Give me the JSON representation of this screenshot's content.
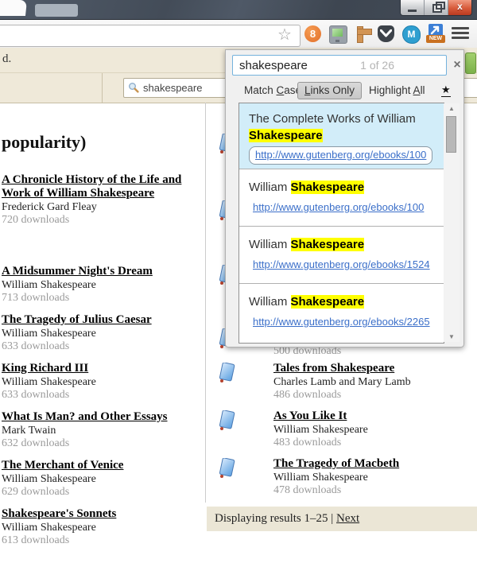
{
  "colors": {
    "titlebar": "#46505d",
    "page_beige": "#efe9d9",
    "find_panel": "#f0f0f0",
    "selected_result": "#d2edf9",
    "highlight": "#ffff00",
    "link_blue": "#3b6fc9"
  },
  "browser": {
    "bookmark_icon": "☆",
    "new_badge": "NEW",
    "menu_icon": "hamburger",
    "extension_icons": [
      "orange-bubble-8",
      "screengrab",
      "measure-ruler",
      "pocket",
      "m-messenger",
      "arrow-new"
    ]
  },
  "findbar": {
    "query": "shakespeare",
    "count": "1 of 26",
    "close": "×",
    "buttons": [
      {
        "pre": "Match ",
        "key": "C",
        "post": "ase"
      },
      {
        "pre": "",
        "key": "L",
        "post": "inks Only"
      },
      {
        "pre": "Highlight ",
        "key": "A",
        "post": "ll"
      }
    ],
    "star": "★",
    "results": [
      {
        "title_pre": "The Complete Works of William ",
        "match": "Shakespeare",
        "url": "http://www.gutenberg.org/ebooks/100"
      },
      {
        "title_pre": "William ",
        "match": "Shakespeare",
        "url": "http://www.gutenberg.org/ebooks/100"
      },
      {
        "title_pre": "William ",
        "match": "Shakespeare",
        "url": "http://www.gutenberg.org/ebooks/1524"
      },
      {
        "title_pre": "William ",
        "match": "Shakespeare",
        "url": "http://www.gutenberg.org/ebooks/2265"
      }
    ]
  },
  "page": {
    "header_fragment": "d.",
    "site_search_value": "shakespeare",
    "heading_fragment": "popularity)",
    "left_books": [
      {
        "title": "A Chronicle History of the Life and Work of William Shakespeare",
        "author": "Frederick Gard Fleay",
        "downloads": "720 downloads"
      },
      {
        "title": "A Midsummer Night's Dream",
        "author": "William Shakespeare",
        "downloads": "713 downloads"
      },
      {
        "title": "The Tragedy of Julius Caesar",
        "author": "William Shakespeare",
        "downloads": "633 downloads"
      },
      {
        "title": "King Richard III",
        "author": "William Shakespeare",
        "downloads": "633 downloads"
      },
      {
        "title": "What Is Man? and Other Essays",
        "author": "Mark Twain",
        "downloads": "632 downloads"
      },
      {
        "title": "The Merchant of Venice",
        "author": "William Shakespeare",
        "downloads": "629 downloads"
      },
      {
        "title": "Shakespeare's Sonnets",
        "author": "William Shakespeare",
        "downloads": "613 downloads"
      }
    ],
    "partial_downloads": "500 downloads",
    "right_books": [
      {
        "title": "Tales from Shakespeare",
        "author": "Charles Lamb and Mary Lamb",
        "downloads": "486 downloads"
      },
      {
        "title": "As You Like It",
        "author": "William Shakespeare",
        "downloads": "483 downloads"
      },
      {
        "title": "The Tragedy of Macbeth",
        "author": "William Shakespeare",
        "downloads": "478 downloads"
      }
    ],
    "pagination_text": "Displaying results 1–25 |",
    "pagination_next": "Next"
  }
}
